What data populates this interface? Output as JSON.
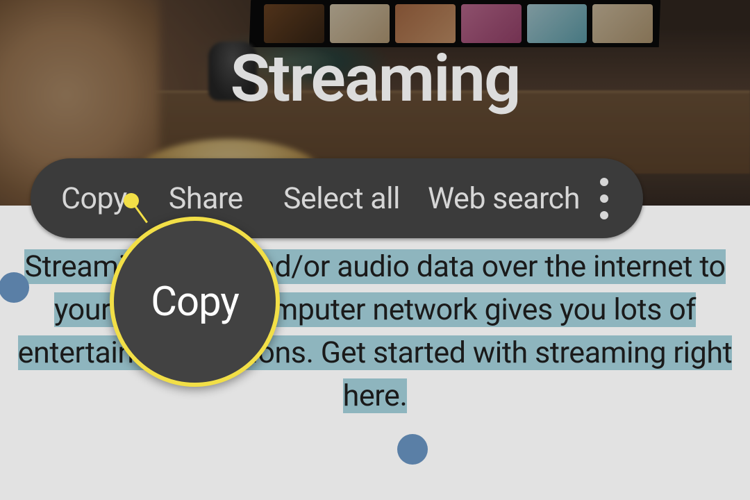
{
  "hero": {
    "title": "Streaming"
  },
  "context_menu": {
    "items": [
      "Copy",
      "Share",
      "Select all",
      "Web search"
    ],
    "more_icon": "more-vertical-icon"
  },
  "article": {
    "selected_text": "Streaming video and/or audio data over the internet to your phone or computer network gives you lots of entertainment options. Get started with streaming right here."
  },
  "callout": {
    "label": "Copy"
  },
  "colors": {
    "highlight": "#8eb5be",
    "selection_handle": "#5a7fa6",
    "context_menu_bg": "#3b3b3b",
    "callout_ring": "#f2df47"
  }
}
